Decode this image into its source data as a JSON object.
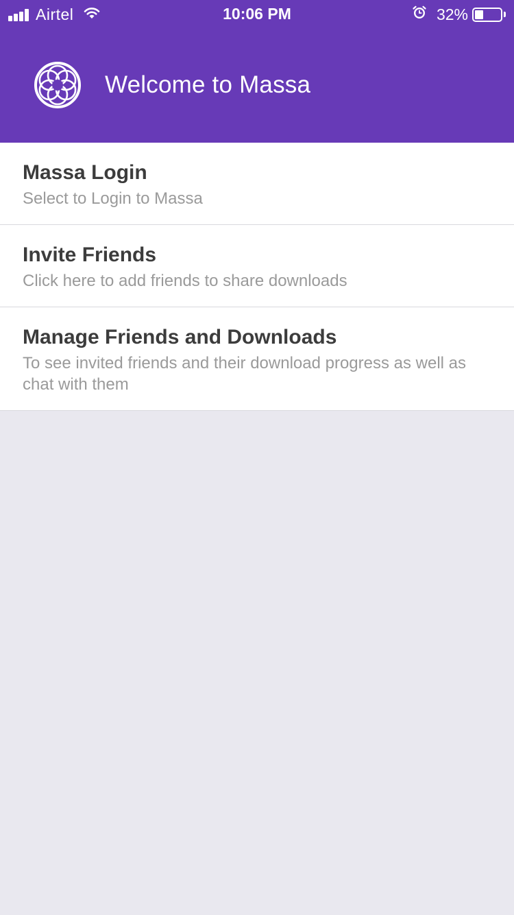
{
  "status_bar": {
    "carrier": "Airtel",
    "time": "10:06 PM",
    "battery_percent_label": "32%",
    "battery_level": 0.32,
    "icons": [
      "signal-icon",
      "wifi-icon",
      "alarm-icon",
      "battery-icon"
    ]
  },
  "header": {
    "title": "Welcome to Massa",
    "logo_icon": "massa-logo-icon",
    "background_color": "#673ab7"
  },
  "menu": {
    "items": [
      {
        "title": "Massa Login",
        "subtitle": "Select to Login to Massa"
      },
      {
        "title": "Invite Friends",
        "subtitle": "Click here to add friends to share downloads"
      },
      {
        "title": "Manage Friends and Downloads",
        "subtitle": "To see invited friends and their download progress as well as chat with them"
      }
    ]
  },
  "colors": {
    "accent": "#673ab7",
    "page_background": "#e9e8ef",
    "title_text": "#3c3c3c",
    "subtitle_text": "#9a9a9a"
  }
}
